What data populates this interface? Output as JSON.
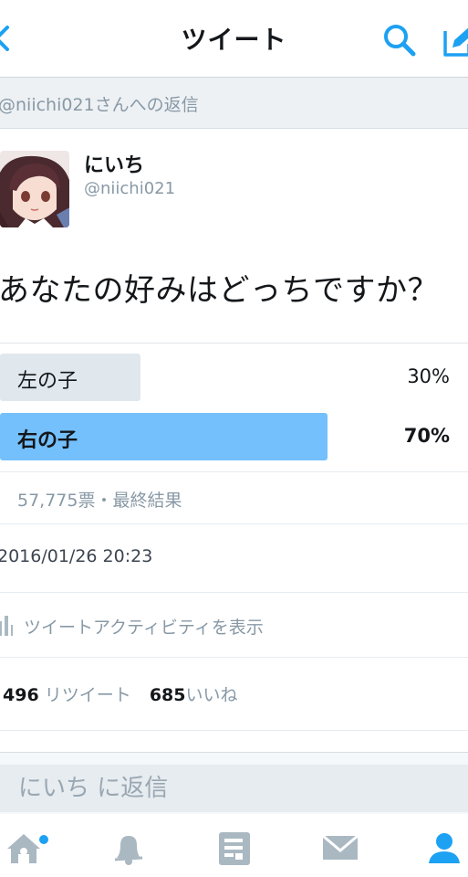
{
  "nav": {
    "title": "ツイート",
    "back_icon": "chevron-left-icon",
    "search_icon": "search-icon",
    "compose_icon": "compose-icon",
    "accent": "#1da1f2"
  },
  "reply_banner": {
    "text": "@niichi021さんへの返信"
  },
  "author": {
    "display_name": "にいち",
    "username": "@niichi021",
    "avatar_icon": "avatar"
  },
  "tweet": {
    "text": "あなたの好みはどっちですか？"
  },
  "poll": {
    "options": [
      {
        "label": "左の子",
        "percent": "30%",
        "share": 0.3,
        "color": "#e1e8ed",
        "leading": false
      },
      {
        "label": "右の子",
        "percent": "70%",
        "share": 0.7,
        "color": "#74c0fc",
        "leading": true
      }
    ],
    "summary": "57,775票・最終結果"
  },
  "timestamp": "2016/01/26 20:23",
  "activity": {
    "label": "ツイートアクティビティを表示",
    "icon": "bar-chart-icon"
  },
  "stats": {
    "retweets_count": "496",
    "retweets_label": "リツイート",
    "likes_count": "685",
    "likes_label": "いいね"
  },
  "reply_input": {
    "placeholder": "にいち に返信"
  },
  "tabbar": {
    "tabs": [
      {
        "name": "home",
        "icon": "home-icon",
        "badge": true
      },
      {
        "name": "notifications",
        "icon": "bell-icon"
      },
      {
        "name": "moments",
        "icon": "moments-icon"
      },
      {
        "name": "messages",
        "icon": "envelope-icon"
      },
      {
        "name": "profile",
        "icon": "person-icon",
        "active": true
      }
    ],
    "inactive_color": "#aab8c2",
    "active_color": "#1da1f2"
  }
}
